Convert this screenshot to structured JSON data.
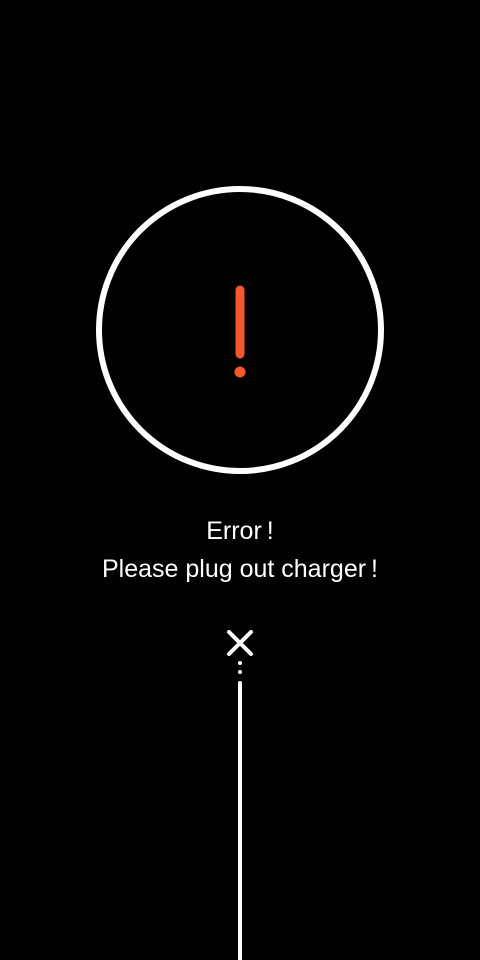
{
  "error": {
    "title": "Error !",
    "message": "Please plug out charger !",
    "icon": "exclamation-icon",
    "accent_color": "#f4582e"
  },
  "unplug_indicator": {
    "icon": "close-icon"
  }
}
